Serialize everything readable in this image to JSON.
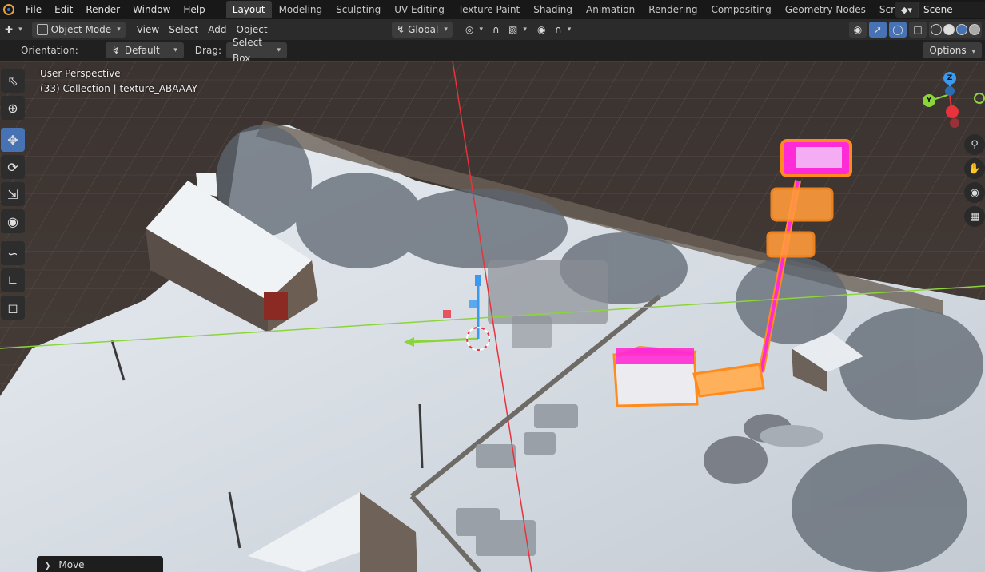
{
  "menu": {
    "items": [
      "File",
      "Edit",
      "Render",
      "Window",
      "Help"
    ]
  },
  "workspaces": {
    "tabs": [
      "Layout",
      "Modeling",
      "Sculpting",
      "UV Editing",
      "Texture Paint",
      "Shading",
      "Animation",
      "Rendering",
      "Compositing",
      "Geometry Nodes",
      "Scripting"
    ],
    "active": "Layout"
  },
  "scene": {
    "name": "Scene"
  },
  "header": {
    "mode": "Object Mode",
    "menus": [
      "View",
      "Select",
      "Add",
      "Object"
    ],
    "transform_orientation": "Global"
  },
  "tool_settings": {
    "orientation_label": "Orientation:",
    "orientation_value": "Default",
    "drag_label": "Drag:",
    "drag_value": "Select Box",
    "options_label": "Options"
  },
  "viewport": {
    "perspective": "User Perspective",
    "collection": "(33) Collection | texture_ABAAAY"
  },
  "gizmo_axes": [
    "Z",
    "Y"
  ],
  "last_operator": "Move",
  "colors": {
    "accent": "#4772b3",
    "selection_orange": "#ff8a1e",
    "selection_magenta": "#ff2bd6",
    "x_axis": "#e8323c",
    "y_axis": "#8cd43c",
    "z_axis": "#3a9af0"
  }
}
